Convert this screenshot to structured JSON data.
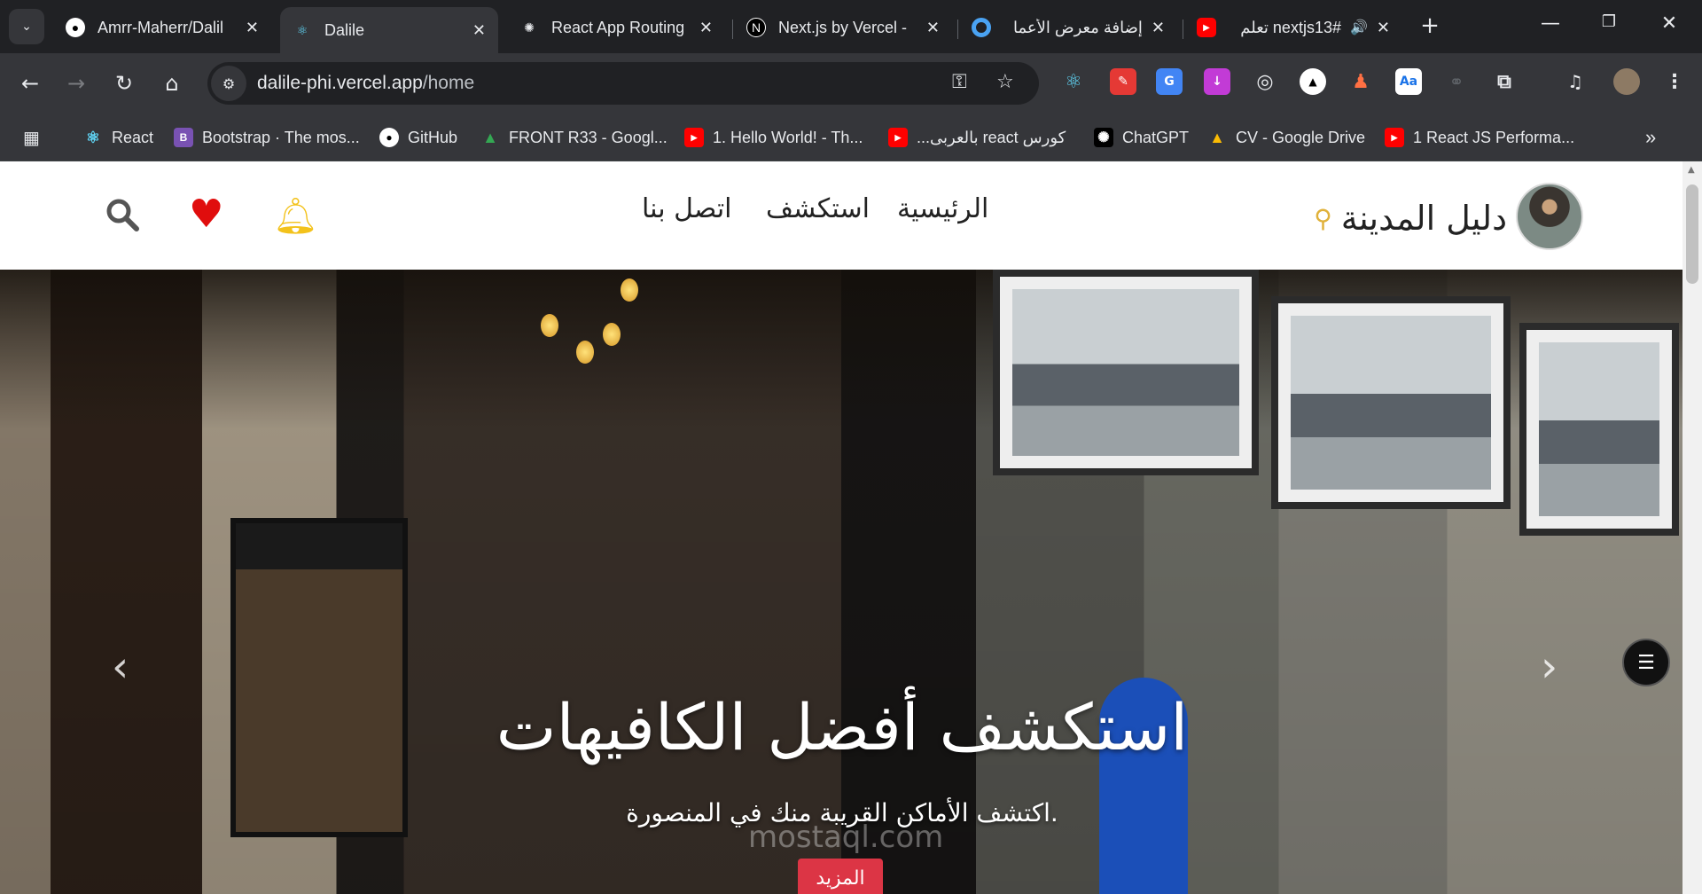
{
  "tabs": [
    {
      "title": "Amrr-Maherr/Dalil",
      "favicon": "github-icon"
    },
    {
      "title": "Dalile",
      "favicon": "react-icon",
      "active": true
    },
    {
      "title": "React App Routing",
      "favicon": "chatgpt-icon"
    },
    {
      "title": "Next.js by Vercel -",
      "favicon": "nextjs-icon"
    },
    {
      "title": "إضافة معرض الأعما",
      "favicon": "blue-circle-icon"
    },
    {
      "title": "nextjs13# تعلم",
      "favicon": "youtube-icon",
      "audio": true
    }
  ],
  "omnibox": {
    "host": "dalile-phi.vercel.app",
    "path": "/home"
  },
  "bookmarks": [
    {
      "label": "React",
      "icon": "react-icon"
    },
    {
      "label": "Bootstrap · The mos...",
      "icon": "bootstrap-icon"
    },
    {
      "label": "GitHub",
      "icon": "github-icon"
    },
    {
      "label": "FRONT R33 - Googl...",
      "icon": "google-drive-icon"
    },
    {
      "label": "1. Hello World! - Th...",
      "icon": "youtube-icon"
    },
    {
      "label": "كورس react بالعربى...",
      "icon": "youtube-icon"
    },
    {
      "label": "ChatGPT",
      "icon": "chatgpt-icon"
    },
    {
      "label": "CV - Google Drive",
      "icon": "google-drive-icon"
    },
    {
      "label": "1 React JS Performa...",
      "icon": "youtube-icon"
    }
  ],
  "site": {
    "brand": "دليل المدينة",
    "nav": {
      "home": "الرئيسية",
      "explore": "استكشف",
      "contact": "اتصل بنا"
    },
    "hero": {
      "title": "استكشف أفضل الكافيهات",
      "subtitle": ".اكتشف الأماكن القريبة منك في المنصورة",
      "button": "المزيد",
      "watermark": "mostaql.com"
    }
  },
  "colors": {
    "accent": "#dc3545",
    "bell": "#f3c21b",
    "heart": "#e00d0d"
  }
}
